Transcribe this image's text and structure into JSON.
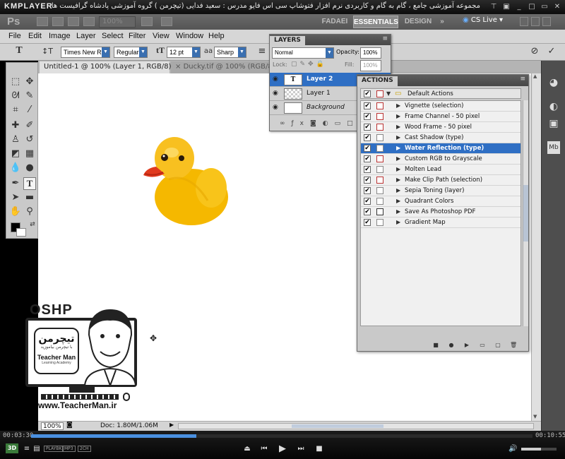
{
  "player": {
    "logo": "KMPLAYER",
    "title": "مجموعه آموزشی جامع ، گام به گام و کاربردی نرم افزار فتوشاپ سی اس فایو  مدرس : سعید فدایی (تیچرمن ) گروه آموزشی پادشاه گرافیست ها",
    "time_elapsed": "00:03:30",
    "time_total": "00:10:55",
    "progress": 0.33,
    "volume": 0.55,
    "badge_3d": "3D",
    "badges": [
      "PLAYBK",
      "MP3",
      "2CH"
    ]
  },
  "appbar": {
    "ps_logo": "Ps",
    "zoom": "100%",
    "workspaces": [
      "FADAEI",
      "ESSENTIALS",
      "DESIGN"
    ],
    "more": "»",
    "cs_live": "CS Live"
  },
  "menu": [
    "File",
    "Edit",
    "Image",
    "Layer",
    "Select",
    "Filter",
    "View",
    "Window",
    "Help"
  ],
  "options": {
    "font_family": "Times New R...",
    "font_style": "Regular",
    "font_size": "12 pt",
    "aa_label": "a",
    "anti_alias": "Sharp"
  },
  "tabs": [
    {
      "label": "Untitled-1 @ 100% (Layer 1, RGB/8) *"
    },
    {
      "label": "Ducky.tif @ 100% (RGB/8)"
    }
  ],
  "layers": {
    "tab": "LAYERS",
    "blend_mode": "Normal",
    "opacity_label": "Opacity:",
    "opacity": "100%",
    "lock_label": "Lock:",
    "fill_label": "Fill:",
    "fill": "100%",
    "items": [
      {
        "name": "Layer 2",
        "thumb": "T",
        "selected": true
      },
      {
        "name": "Layer 1",
        "thumb": "",
        "selected": false
      },
      {
        "name": "Background",
        "thumb": "",
        "selected": false
      }
    ]
  },
  "actions": {
    "tab": "ACTIONS",
    "set_name": "Default Actions",
    "items": [
      {
        "name": "Vignette (selection)",
        "dialog": true
      },
      {
        "name": "Frame Channel - 50 pixel",
        "dialog": true
      },
      {
        "name": "Wood Frame - 50 pixel",
        "dialog": true
      },
      {
        "name": "Cast Shadow (type)",
        "dialog": false
      },
      {
        "name": "Water Reflection (type)",
        "dialog": false,
        "selected": true
      },
      {
        "name": "Custom RGB to Grayscale",
        "dialog": true
      },
      {
        "name": "Molten Lead",
        "dialog": false
      },
      {
        "name": "Make Clip Path (selection)",
        "dialog": true
      },
      {
        "name": "Sepia Toning (layer)",
        "dialog": false
      },
      {
        "name": "Quadrant Colors",
        "dialog": false
      },
      {
        "name": "Save As Photoshop PDF",
        "dialog": true
      },
      {
        "name": "Gradient Map",
        "dialog": false
      }
    ]
  },
  "status": {
    "zoom": "100%",
    "doc": "Doc: 1.80M/1.06M"
  },
  "watermark": {
    "top_text": "OSHP",
    "brand_fa": "تیچرمن",
    "tagline_fa": "با تیچرمن بیاموزید",
    "brand_en": "Teacher Man",
    "sub_en": "Learning Academy",
    "url": "www.TeacherMan.ir"
  },
  "colors": {
    "selection_blue": "#2f6fc4",
    "duck_yellow": "#f5b800",
    "duck_beak": "#e03a1e"
  }
}
